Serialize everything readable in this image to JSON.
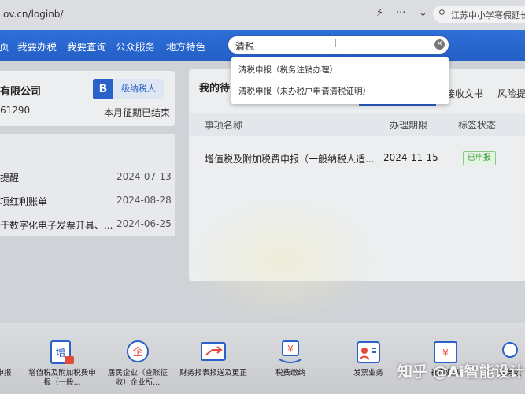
{
  "browser": {
    "url": "ov.cn/loginb/",
    "search_text": "江苏中小学寒假延长",
    "icons": [
      "bolt-icon",
      "more-icon",
      "search-icon"
    ]
  },
  "nav": {
    "items": [
      "页",
      "我要办税",
      "我要查询",
      "公众服务",
      "地方特色"
    ],
    "search_value": "清税",
    "suggestions": [
      "清税申报（税务注销办理）",
      "清税申报（未办税户申请清税证明）"
    ]
  },
  "company": {
    "name": "有限公司",
    "tax_id": "61290",
    "badge_letter": "B",
    "level": "级纳税人",
    "period_status": "本月征期已结束"
  },
  "notices": [
    {
      "title": "提醒",
      "date": "2024-07-13"
    },
    {
      "title": "项红利账单",
      "date": "2024-08-28"
    },
    {
      "title": "于数字化电子发票开具、...",
      "date": "2024-06-25"
    }
  ],
  "todo": {
    "title": "我的待",
    "tabs": [
      "...",
      "接收文书",
      "风险提"
    ],
    "columns": [
      "事项名称",
      "办理期限",
      "标签状态"
    ],
    "rows": [
      {
        "name": "增值税及附加税费申报（一般纳税人适...",
        "deadline": "2024-11-15",
        "status": "已申报"
      }
    ]
  },
  "services": [
    {
      "label": "申报",
      "icon": "report-icon"
    },
    {
      "label": "增值税及附加税费申报（一般...",
      "icon": "vat-increase-icon"
    },
    {
      "label": "居民企业（查账征收）企业所...",
      "icon": "enterprise-icon"
    },
    {
      "label": "财务报表报送及更正",
      "icon": "financial-report-icon"
    },
    {
      "label": "税费缴纳",
      "icon": "tax-payment-icon"
    },
    {
      "label": "发票业务",
      "icon": "invoice-icon"
    },
    {
      "label": "社保业务",
      "icon": "social-security-icon"
    },
    {
      "label": "税务数",
      "icon": "tax-data-icon"
    }
  ],
  "watermark": "知乎 @Ai智能设计"
}
